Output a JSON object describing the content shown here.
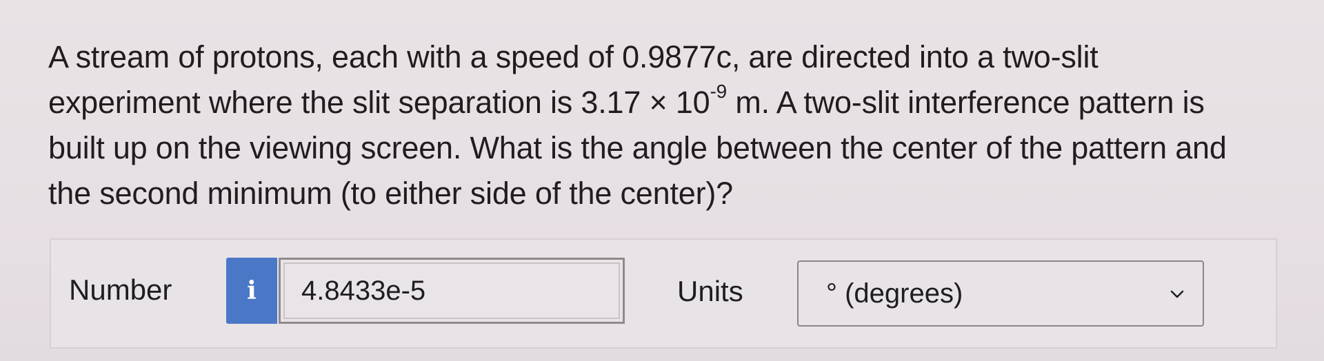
{
  "question": {
    "line1": "A stream of protons, each with a speed of 0.9877c, are directed into a two-slit",
    "line2_pre": "experiment where the slit separation is 3.17 × 10",
    "line2_exp": "-9",
    "line2_post": " m. A two-slit interference pattern is",
    "line3": "built up on the viewing screen. What is the angle between the center of the pattern and",
    "line4": "the second minimum (to either side of the center)?"
  },
  "answer": {
    "number_label": "Number",
    "info_glyph": "i",
    "number_value": "4.8433e-5",
    "units_label": "Units",
    "units_selected": "° (degrees)"
  },
  "icons": {
    "info": "info-icon",
    "dropdown": "chevron-down-icon"
  },
  "colors": {
    "info_button": "#4a78c6",
    "background": "#e8e3e6"
  }
}
